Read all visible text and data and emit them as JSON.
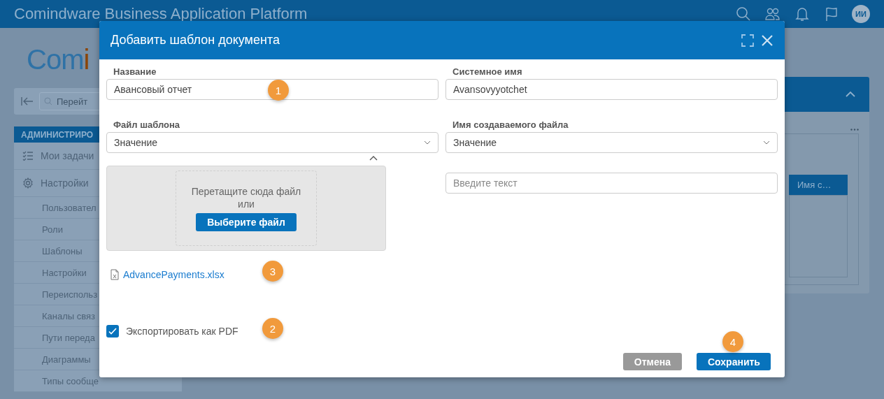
{
  "app_bar": {
    "title": "Comindware Business Application Platform",
    "avatar": "ИИ"
  },
  "logo": {
    "first": "Com",
    "second": "i"
  },
  "sidebar": {
    "search_placeholder": "Перейт",
    "section": "АДМИНИСТРИРО",
    "items": [
      {
        "label": "Мои задачи",
        "kind": "tasks"
      },
      {
        "label": "Настройки",
        "kind": "settings"
      },
      {
        "label": "Пользовател",
        "kind": "sub"
      },
      {
        "label": "Роли",
        "kind": "sub"
      },
      {
        "label": "Шаблоны",
        "kind": "sub"
      },
      {
        "label": "Настройки",
        "kind": "sub"
      },
      {
        "label": "Переиспольз",
        "kind": "sub"
      },
      {
        "label": "Каналы связ",
        "kind": "sub"
      },
      {
        "label": "Пути переда",
        "kind": "sub"
      },
      {
        "label": "Диаграммы",
        "kind": "sub"
      },
      {
        "label": "Типы сообще",
        "kind": "sub"
      }
    ]
  },
  "right_panel": {
    "column": "Имя с…"
  },
  "dialog": {
    "title": "Добавить шаблон документа",
    "left_fields": [
      {
        "label": "Название",
        "value": "Авансовый отчет",
        "kind": "text"
      },
      {
        "label": "Файл шаблона",
        "value": "Значение",
        "kind": "select"
      }
    ],
    "right_fields": [
      {
        "label": "Системное имя",
        "value": "Avansovyyotchet",
        "kind": "text"
      },
      {
        "label": "Имя создаваемого файла",
        "value": "Значение",
        "kind": "select"
      }
    ],
    "extra_field": {
      "placeholder": "Введите текст"
    },
    "dropzone": {
      "text": "Перетащите сюда файл",
      "or": "или",
      "button": "Выберите файл"
    },
    "file": {
      "name": "AdvancePayments.xlsx"
    },
    "export_pdf": {
      "label": "Экспортировать как PDF",
      "checked": true
    },
    "buttons": [
      {
        "label": "Отмена",
        "kind": "secondary"
      },
      {
        "label": "Сохранить",
        "kind": "primary"
      }
    ],
    "callouts": [
      "1",
      "2",
      "3",
      "4"
    ]
  }
}
